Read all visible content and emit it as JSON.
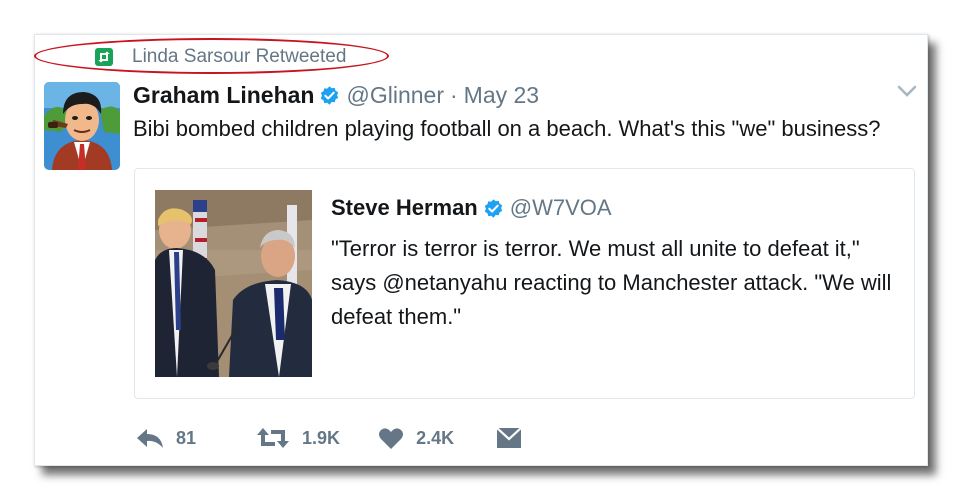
{
  "context": {
    "label": "Linda Sarsour Retweeted",
    "icon": "retweet-icon",
    "highlight_color": "#c8141e"
  },
  "tweet": {
    "author_name": "Graham Linehan",
    "handle": "@Glinner",
    "separator": "·",
    "date": "May 23",
    "text": "Bibi bombed children playing football on a beach. What's this \"we\" business?",
    "verified_icon": "verified-badge-icon",
    "menu_icon": "chevron-down-icon"
  },
  "quote": {
    "author_name": "Steve Herman",
    "handle": "@W7VOA",
    "text": "\"Terror is terror is terror. We must all unite to defeat it,\" says @netanyahu reacting to Manchester attack. \"We will defeat them.\""
  },
  "actions": {
    "reply_count": "81",
    "retweet_count": "1.9K",
    "like_count": "2.4K",
    "icons": [
      "reply-icon",
      "retweet-icon",
      "heart-icon",
      "envelope-icon"
    ]
  },
  "colors": {
    "text": "#14171a",
    "muted": "#657786",
    "verified": "#1da1f2",
    "retweet_green": "#19a356",
    "border": "#e1e8ed"
  }
}
